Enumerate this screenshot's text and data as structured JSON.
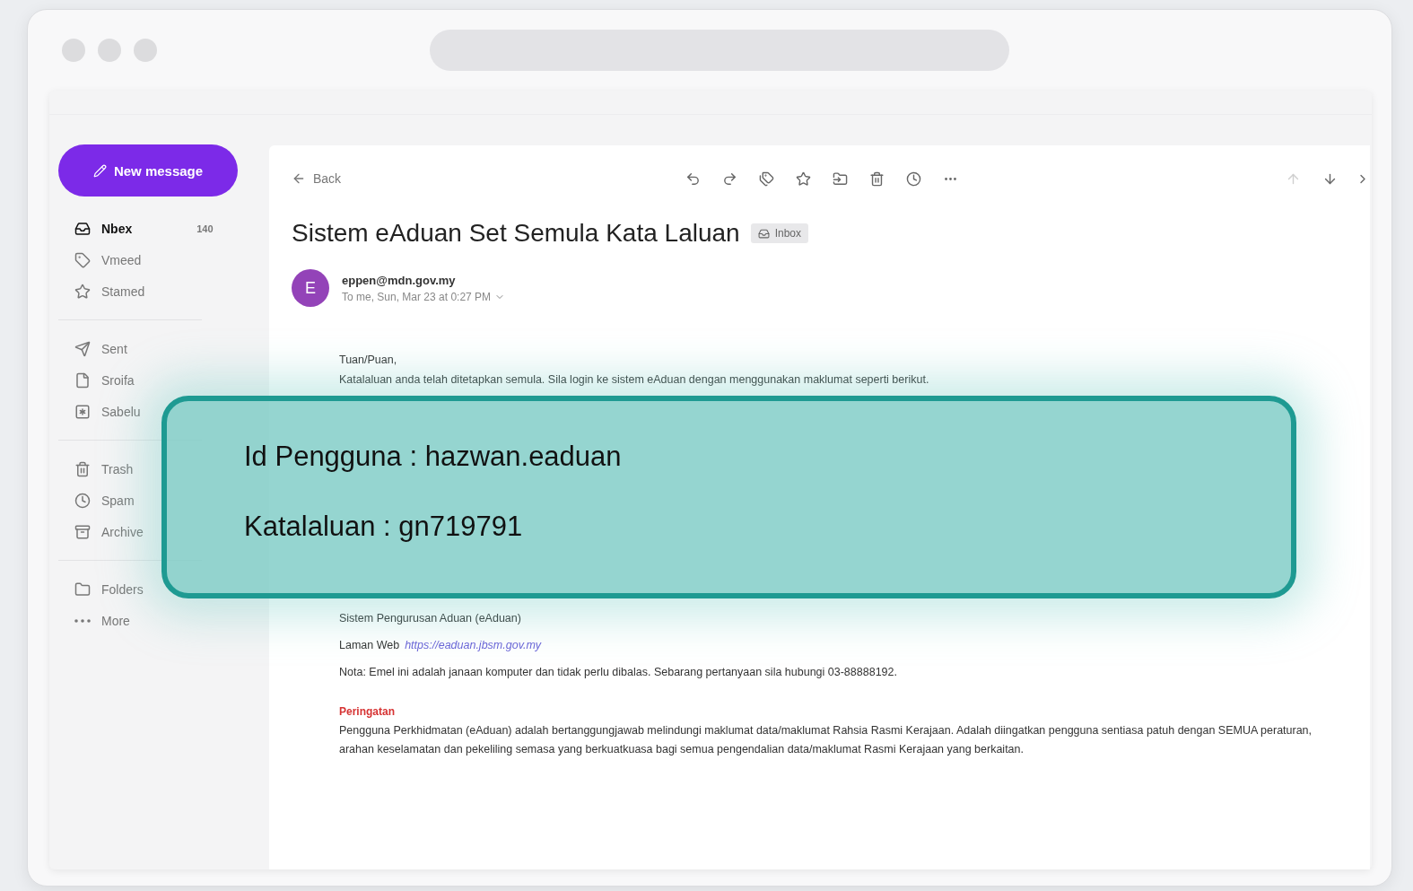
{
  "sidebar": {
    "compose": "New message",
    "items": [
      {
        "label": "Nbex",
        "count": "140",
        "selected": true
      },
      {
        "label": "Vmeed",
        "selected": false
      },
      {
        "label": "Stamed",
        "selected": false
      },
      {
        "label": "Sent",
        "selected": false
      },
      {
        "label": "Sroifa",
        "selected": false
      },
      {
        "label": "Sabelu",
        "selected": false
      },
      {
        "label": "Trash",
        "selected": false
      },
      {
        "label": "Spam",
        "selected": false
      },
      {
        "label": "Archive",
        "selected": false
      },
      {
        "label": "Folders",
        "selected": false
      },
      {
        "label": "More",
        "selected": false
      }
    ]
  },
  "toolbar": {
    "back": "Back",
    "prev_disabled": true
  },
  "message": {
    "subject": "Sistem eAduan Set Semula Kata Laluan",
    "tag": "Inbox",
    "avatar": "E",
    "sender": "eppen@mdn.gov.my",
    "meta": "To me, Sun, Mar 23 at 0:27 PM",
    "body": [
      {
        "kind": "text",
        "text": "Tuan/Puan,"
      },
      {
        "kind": "lead",
        "text": "Katalaluan anda telah ditetapkan semula. Sila login ke sistem eAduan dengan menggunakan maklumat seperti berikut."
      },
      {
        "kind": "gap"
      },
      {
        "kind": "text",
        "text": "Sistem Pengurusan Aduan (eAduan)"
      },
      {
        "kind": "link",
        "text": "Laman Web",
        "link": "https://eaduan.jbsm.gov.my"
      },
      {
        "kind": "text",
        "text": "Nota: Emel ini adalah janaan komputer dan tidak perlu dibalas. Sebarang pertanyaan sila hubungi 03-88888192."
      },
      {
        "kind": "warning",
        "text": "Peringatan"
      },
      {
        "kind": "para",
        "text": "Pengguna Perkhidmatan (eAduan) adalah bertanggungjawab melindungi maklumat data/maklumat Rahsia Rasmi Kerajaan. Adalah diingatkan pengguna sentiasa patuh dengan SEMUA peraturan, arahan keselamatan dan pekeliling semasa yang berkuatkuasa bagi semua pengendalian data/maklumat Rasmi Kerajaan yang berkaitan."
      }
    ]
  },
  "highlight": {
    "lines": [
      "Id Pengguna : hazwan.eaduan",
      "Katalaluan : gn719791"
    ]
  }
}
